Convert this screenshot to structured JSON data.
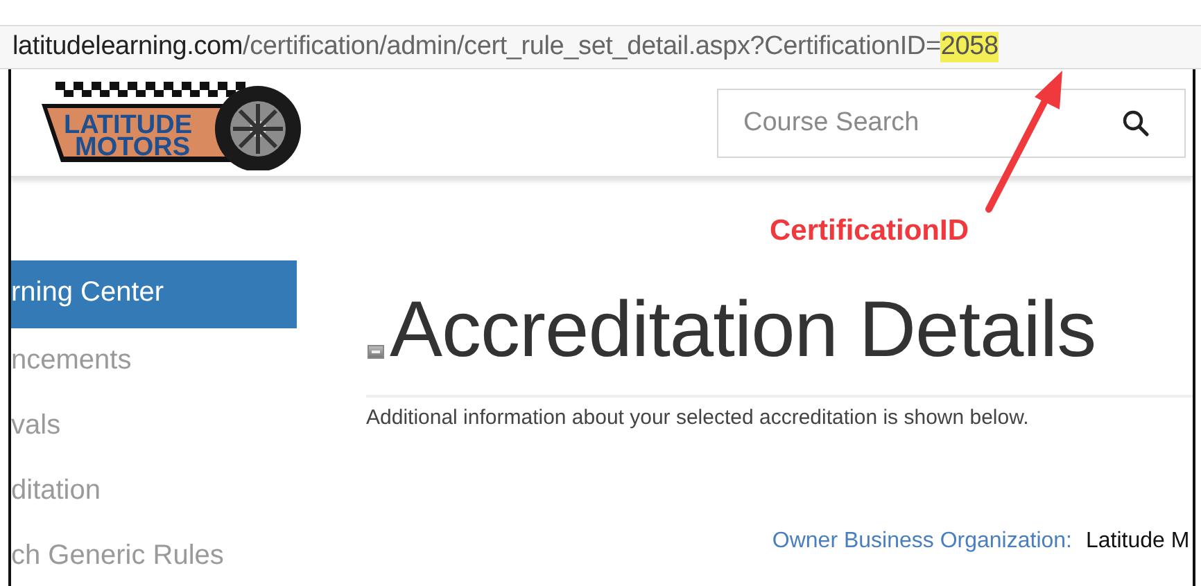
{
  "address_bar": {
    "domain": "latitudelearning.com",
    "path": "/certification/admin/cert_rule_set_detail.aspx?CertificationID=",
    "highlighted_value": "2058"
  },
  "logo": {
    "line_1": "LATITUDE",
    "line_2": "MOTORS"
  },
  "search": {
    "placeholder": "Course Search"
  },
  "sidebar": {
    "items": [
      {
        "label": "rning Center",
        "selected": true
      },
      {
        "label": "ncements",
        "selected": false
      },
      {
        "label": "vals",
        "selected": false
      },
      {
        "label": "ditation",
        "selected": false
      },
      {
        "label": "ch Generic Rules",
        "selected": false
      }
    ]
  },
  "page": {
    "title": "Accreditation Details",
    "description": "Additional information about your selected accreditation is shown below.",
    "fields": [
      {
        "label": "Owner Business Organization:",
        "value": "Latitude M"
      }
    ]
  },
  "annotation": {
    "label": "CertificationID"
  }
}
